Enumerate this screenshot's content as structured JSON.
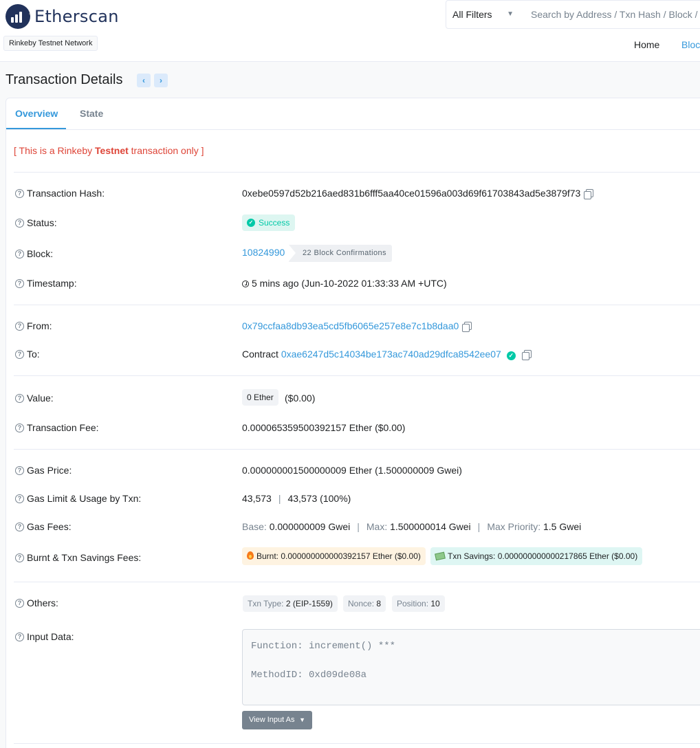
{
  "header": {
    "logo_text": "Etherscan",
    "network": "Rinkeby Testnet Network",
    "filter_label": "All Filters",
    "search_placeholder": "Search by Address / Txn Hash / Block / Token / Ens",
    "nav": [
      "Home",
      "Blockchain"
    ]
  },
  "page": {
    "title": "Transaction Details",
    "prev_glyph": "‹",
    "next_glyph": "›"
  },
  "tabs": [
    "Overview",
    "State"
  ],
  "note": {
    "prefix": "[ This is a Rinkeby ",
    "bold": "Testnet",
    "suffix": " transaction only ]"
  },
  "rows": {
    "hash": {
      "label": "Transaction Hash:",
      "value": "0xebe0597d52b216aed831b6fff5aa40ce01596a003d69f61703843ad5e3879f73"
    },
    "status": {
      "label": "Status:",
      "value": "Success"
    },
    "block": {
      "label": "Block:",
      "value": "10824990",
      "confirmations": "22 Block Confirmations"
    },
    "timestamp": {
      "label": "Timestamp:",
      "value": "5 mins ago (Jun-10-2022 01:33:33 AM +UTC)"
    },
    "from": {
      "label": "From:",
      "value": "0x79ccfaa8db93ea5cd5fb6065e257e8e7c1b8daa0"
    },
    "to": {
      "label": "To:",
      "prefix": "Contract",
      "value": "0xae6247d5c14034be173ac740ad29dfca8542ee07"
    },
    "value": {
      "label": "Value:",
      "amount": "0 Ether",
      "usd": "($0.00)"
    },
    "fee": {
      "label": "Transaction Fee:",
      "value": "0.000065359500392157 Ether ($0.00)"
    },
    "gas_price": {
      "label": "Gas Price:",
      "value": "0.000000001500000009 Ether (1.500000009 Gwei)"
    },
    "gas_limit": {
      "label": "Gas Limit & Usage by Txn:",
      "limit": "43,573",
      "separator": "|",
      "usage": "43,573 (100%)"
    },
    "gas_fees": {
      "label": "Gas Fees:",
      "base_label": "Base:",
      "base_value": "0.000000009 Gwei",
      "max_label": "Max:",
      "max_value": "1.500000014 Gwei",
      "priority_label": "Max Priority:",
      "priority_value": "1.5 Gwei",
      "separator": "|"
    },
    "burnt": {
      "label": "Burnt & Txn Savings Fees:",
      "burnt_text": "Burnt: 0.000000000000392157 Ether ($0.00)",
      "savings_text": "Txn Savings: 0.000000000000217865 Ether ($0.00)"
    },
    "others": {
      "label": "Others:",
      "txn_type_label": "Txn Type:",
      "txn_type_value": "2 (EIP-1559)",
      "nonce_label": "Nonce:",
      "nonce_value": "8",
      "position_label": "Position:",
      "position_value": "10"
    },
    "input": {
      "label": "Input Data:",
      "line1": "Function: increment() ***",
      "line2": "MethodID: 0xd09de08a",
      "button": "View Input As"
    }
  },
  "colors": {
    "link": "#3498db",
    "success": "#00c9a7",
    "danger": "#de4437",
    "brand": "#21325b"
  }
}
